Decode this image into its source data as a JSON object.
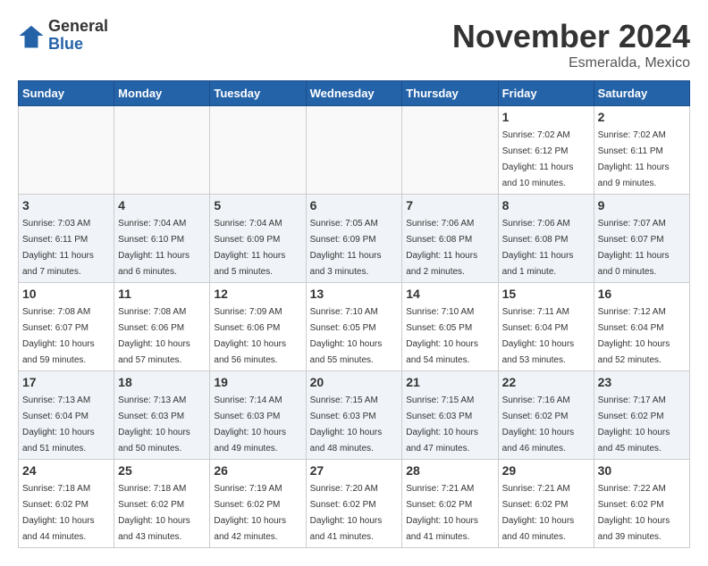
{
  "logo": {
    "general": "General",
    "blue": "Blue"
  },
  "title": {
    "month": "November 2024",
    "location": "Esmeralda, Mexico"
  },
  "weekdays": [
    "Sunday",
    "Monday",
    "Tuesday",
    "Wednesday",
    "Thursday",
    "Friday",
    "Saturday"
  ],
  "weeks": [
    [
      {
        "day": "",
        "info": ""
      },
      {
        "day": "",
        "info": ""
      },
      {
        "day": "",
        "info": ""
      },
      {
        "day": "",
        "info": ""
      },
      {
        "day": "",
        "info": ""
      },
      {
        "day": "1",
        "info": "Sunrise: 7:02 AM\nSunset: 6:12 PM\nDaylight: 11 hours and 10 minutes."
      },
      {
        "day": "2",
        "info": "Sunrise: 7:02 AM\nSunset: 6:11 PM\nDaylight: 11 hours and 9 minutes."
      }
    ],
    [
      {
        "day": "3",
        "info": "Sunrise: 7:03 AM\nSunset: 6:11 PM\nDaylight: 11 hours and 7 minutes."
      },
      {
        "day": "4",
        "info": "Sunrise: 7:04 AM\nSunset: 6:10 PM\nDaylight: 11 hours and 6 minutes."
      },
      {
        "day": "5",
        "info": "Sunrise: 7:04 AM\nSunset: 6:09 PM\nDaylight: 11 hours and 5 minutes."
      },
      {
        "day": "6",
        "info": "Sunrise: 7:05 AM\nSunset: 6:09 PM\nDaylight: 11 hours and 3 minutes."
      },
      {
        "day": "7",
        "info": "Sunrise: 7:06 AM\nSunset: 6:08 PM\nDaylight: 11 hours and 2 minutes."
      },
      {
        "day": "8",
        "info": "Sunrise: 7:06 AM\nSunset: 6:08 PM\nDaylight: 11 hours and 1 minute."
      },
      {
        "day": "9",
        "info": "Sunrise: 7:07 AM\nSunset: 6:07 PM\nDaylight: 11 hours and 0 minutes."
      }
    ],
    [
      {
        "day": "10",
        "info": "Sunrise: 7:08 AM\nSunset: 6:07 PM\nDaylight: 10 hours and 59 minutes."
      },
      {
        "day": "11",
        "info": "Sunrise: 7:08 AM\nSunset: 6:06 PM\nDaylight: 10 hours and 57 minutes."
      },
      {
        "day": "12",
        "info": "Sunrise: 7:09 AM\nSunset: 6:06 PM\nDaylight: 10 hours and 56 minutes."
      },
      {
        "day": "13",
        "info": "Sunrise: 7:10 AM\nSunset: 6:05 PM\nDaylight: 10 hours and 55 minutes."
      },
      {
        "day": "14",
        "info": "Sunrise: 7:10 AM\nSunset: 6:05 PM\nDaylight: 10 hours and 54 minutes."
      },
      {
        "day": "15",
        "info": "Sunrise: 7:11 AM\nSunset: 6:04 PM\nDaylight: 10 hours and 53 minutes."
      },
      {
        "day": "16",
        "info": "Sunrise: 7:12 AM\nSunset: 6:04 PM\nDaylight: 10 hours and 52 minutes."
      }
    ],
    [
      {
        "day": "17",
        "info": "Sunrise: 7:13 AM\nSunset: 6:04 PM\nDaylight: 10 hours and 51 minutes."
      },
      {
        "day": "18",
        "info": "Sunrise: 7:13 AM\nSunset: 6:03 PM\nDaylight: 10 hours and 50 minutes."
      },
      {
        "day": "19",
        "info": "Sunrise: 7:14 AM\nSunset: 6:03 PM\nDaylight: 10 hours and 49 minutes."
      },
      {
        "day": "20",
        "info": "Sunrise: 7:15 AM\nSunset: 6:03 PM\nDaylight: 10 hours and 48 minutes."
      },
      {
        "day": "21",
        "info": "Sunrise: 7:15 AM\nSunset: 6:03 PM\nDaylight: 10 hours and 47 minutes."
      },
      {
        "day": "22",
        "info": "Sunrise: 7:16 AM\nSunset: 6:02 PM\nDaylight: 10 hours and 46 minutes."
      },
      {
        "day": "23",
        "info": "Sunrise: 7:17 AM\nSunset: 6:02 PM\nDaylight: 10 hours and 45 minutes."
      }
    ],
    [
      {
        "day": "24",
        "info": "Sunrise: 7:18 AM\nSunset: 6:02 PM\nDaylight: 10 hours and 44 minutes."
      },
      {
        "day": "25",
        "info": "Sunrise: 7:18 AM\nSunset: 6:02 PM\nDaylight: 10 hours and 43 minutes."
      },
      {
        "day": "26",
        "info": "Sunrise: 7:19 AM\nSunset: 6:02 PM\nDaylight: 10 hours and 42 minutes."
      },
      {
        "day": "27",
        "info": "Sunrise: 7:20 AM\nSunset: 6:02 PM\nDaylight: 10 hours and 41 minutes."
      },
      {
        "day": "28",
        "info": "Sunrise: 7:21 AM\nSunset: 6:02 PM\nDaylight: 10 hours and 41 minutes."
      },
      {
        "day": "29",
        "info": "Sunrise: 7:21 AM\nSunset: 6:02 PM\nDaylight: 10 hours and 40 minutes."
      },
      {
        "day": "30",
        "info": "Sunrise: 7:22 AM\nSunset: 6:02 PM\nDaylight: 10 hours and 39 minutes."
      }
    ]
  ]
}
